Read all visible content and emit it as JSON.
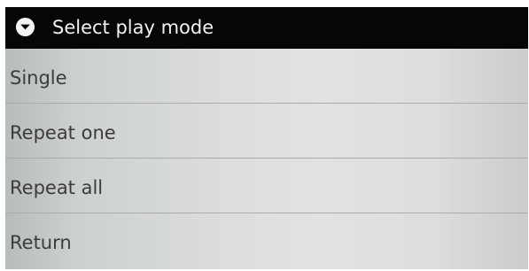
{
  "dialog": {
    "title": "Select play mode",
    "title_icon": "circle-chevron-down-icon",
    "colors": {
      "title_bar": "#060606",
      "title_text": "#f2f2f2",
      "item_text": "#3a3c3d",
      "list_background": "#dcdedd"
    },
    "items": [
      {
        "label": "Single"
      },
      {
        "label": "Repeat one"
      },
      {
        "label": "Repeat all"
      },
      {
        "label": "Return"
      }
    ]
  }
}
